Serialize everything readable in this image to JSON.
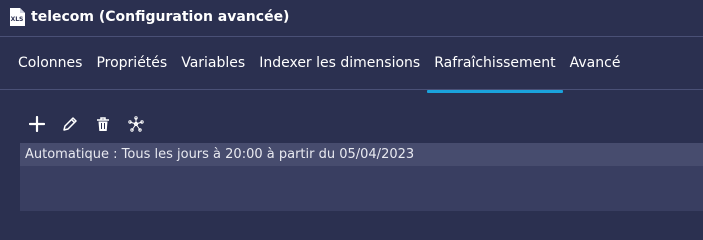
{
  "window": {
    "file_badge": "XLS",
    "title": "telecom (Configuration avancée)"
  },
  "tabs": [
    {
      "label": "Colonnes"
    },
    {
      "label": "Propriétés"
    },
    {
      "label": "Variables"
    },
    {
      "label": "Indexer les dimensions"
    },
    {
      "label": "Rafraîchissement",
      "active": true
    },
    {
      "label": "Avancé"
    }
  ],
  "toolbar": {
    "icons": [
      "plus-icon",
      "edit-icon",
      "trash-icon",
      "network-icon"
    ]
  },
  "refresh_list": {
    "items": [
      {
        "text": "Automatique : Tous les jours à 20:00 à partir du 05/04/2023"
      }
    ]
  },
  "colors": {
    "background": "#2b3050",
    "accent": "#1aa3dd",
    "list_bg": "#393e61",
    "list_item_bg": "#474c6e"
  }
}
